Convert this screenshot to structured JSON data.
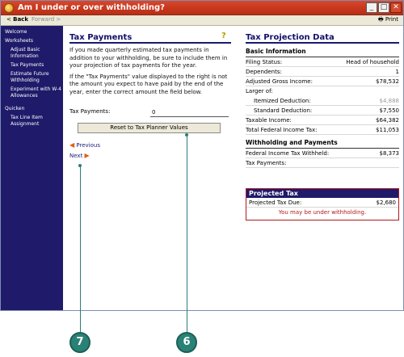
{
  "window": {
    "title": "Am I under or over withholding?",
    "minimize_glyph": "_",
    "maximize_glyph": "□",
    "close_glyph": "✕"
  },
  "toolbar": {
    "back_label": "Back",
    "forward_label": "Forward",
    "print_label": "Print"
  },
  "sidebar": {
    "welcome": "Welcome",
    "worksheets": "Worksheets",
    "items": [
      "Adjust Basic Information",
      "Tax Payments",
      "Estimate Future Withholding",
      "Experiment with W-4 Allowances"
    ],
    "quicken": "Quicken",
    "quicken_items": [
      "Tax Line Item Assignment"
    ]
  },
  "left": {
    "title": "Tax Payments",
    "help_glyph": "?",
    "para1": "If you made quarterly estimated tax payments in addition to your withholding, be sure to include them in your projection of tax payments for the year.",
    "para2": "If the \"Tax Payments\" value displayed to the right is not the amount you expect to have paid by the end of the year, enter the correct amount the field below.",
    "tax_payments_label": "Tax Payments:",
    "tax_payments_value": "0",
    "reset_label": "Reset to Tax Planner Values",
    "previous_label": "Previous",
    "next_label": "Next"
  },
  "right": {
    "title": "Tax Projection Data",
    "basic_title": "Basic Information",
    "filing_status_label": "Filing Status:",
    "filing_status_value": "Head of household",
    "dependents_label": "Dependents:",
    "dependents_value": "1",
    "agi_label": "Adjusted Gross Income:",
    "agi_value": "$78,532",
    "larger_of_label": "Larger of:",
    "itemized_label": "Itemized Deduction:",
    "itemized_value": "$4,888",
    "standard_label": "Standard Deduction:",
    "standard_value": "$7,550",
    "taxable_label": "Taxable Income:",
    "taxable_value": "$64,382",
    "total_tax_label": "Total Federal Income Tax:",
    "total_tax_value": "$11,053",
    "wp_title": "Withholding and Payments",
    "withheld_label": "Federal Income Tax Withheld:",
    "withheld_value": "$8,373",
    "payments_label": "Tax Payments:",
    "payments_value": ""
  },
  "projected": {
    "title": "Projected Tax",
    "due_label": "Projected Tax Due:",
    "due_value": "$2,680",
    "warning": "You may be under withholding."
  },
  "callouts": {
    "seven": "7",
    "six": "6"
  },
  "colors": {
    "title_bar": "#c7371d",
    "sidebar": "#1f1a6a",
    "callout": "#2a8276",
    "warning": "#b31b1b"
  }
}
